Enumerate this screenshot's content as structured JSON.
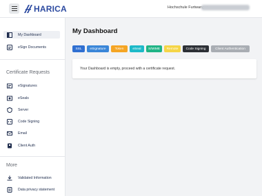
{
  "header": {
    "logo_text": "HARICA",
    "organization": "Hochschule Furtwangen"
  },
  "sidebar": {
    "top_items": [
      {
        "label": "My Dashboard",
        "icon": "dashboard-icon"
      },
      {
        "label": "eSign Documents",
        "icon": "document-icon"
      }
    ],
    "certificate_requests": {
      "title": "Certificate Requests",
      "items": [
        {
          "label": "eSignatures",
          "icon": "signature-icon"
        },
        {
          "label": "eSeals",
          "icon": "seal-icon"
        },
        {
          "label": "Server",
          "icon": "server-icon"
        },
        {
          "label": "Code Signing",
          "icon": "code-icon"
        },
        {
          "label": "Email",
          "icon": "email-icon"
        },
        {
          "label": "Client Auth",
          "icon": "id-card-icon"
        }
      ]
    },
    "more": {
      "title": "More",
      "items": [
        {
          "label": "Validated Information",
          "icon": "download-icon"
        },
        {
          "label": "Data privacy statement",
          "icon": "privacy-icon"
        }
      ]
    }
  },
  "main": {
    "title": "My Dashboard",
    "badges": [
      {
        "label": "SSL",
        "color": "#2f6fd1"
      },
      {
        "label": "eSignature",
        "color": "#3a86d8"
      },
      {
        "label": "Token",
        "color": "#f5a524"
      },
      {
        "label": "eSeal",
        "color": "#1db9c8"
      },
      {
        "label": "S/MIME",
        "color": "#20b486"
      },
      {
        "label": "Remote",
        "color": "#f5d547"
      },
      {
        "label": "Code Signing",
        "color": "#2d3036"
      },
      {
        "label": "Client Authentication",
        "color": "#a9adb3"
      }
    ],
    "empty_message": "Your Dashboard is empty, proceed with a certificate request."
  }
}
